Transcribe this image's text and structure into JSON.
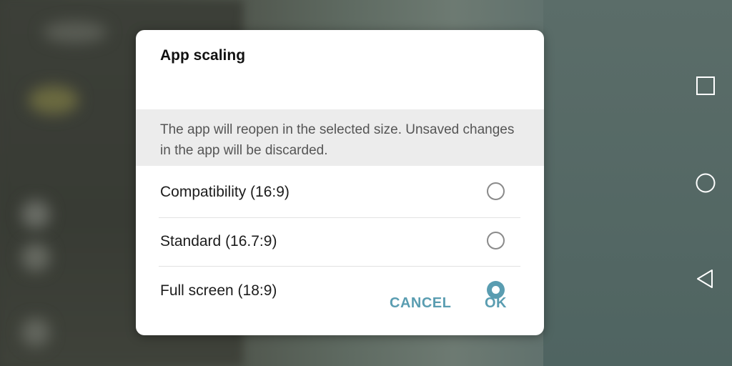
{
  "dialog": {
    "title": "App scaling",
    "message": "The app will reopen in the selected size. Unsaved changes in the app will be discarded.",
    "options": [
      {
        "label": "Compatibility (16:9)",
        "selected": false
      },
      {
        "label": "Standard (16.7:9)",
        "selected": false
      },
      {
        "label": "Full screen (18:9)",
        "selected": true
      }
    ],
    "cancel_label": "CANCEL",
    "ok_label": "OK"
  },
  "navigation_bar": {
    "buttons": [
      {
        "icon": "recents-square-icon"
      },
      {
        "icon": "home-circle-icon"
      },
      {
        "icon": "back-triangle-icon"
      }
    ]
  },
  "colors": {
    "accent": "#5a9db1",
    "dialog_background": "#ffffff",
    "message_background": "#ececec"
  }
}
